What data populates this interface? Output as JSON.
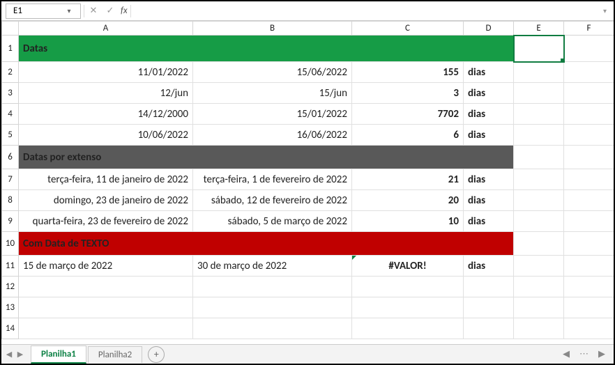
{
  "nameBox": {
    "value": "E1"
  },
  "fx": {
    "cancel": "✕",
    "confirm": "✓",
    "label": "fx"
  },
  "columns": [
    "A",
    "B",
    "C",
    "D",
    "E",
    "F"
  ],
  "rowNums": [
    "1",
    "2",
    "3",
    "4",
    "5",
    "6",
    "7",
    "8",
    "9",
    "10",
    "11",
    "12",
    "13",
    "14"
  ],
  "section1": {
    "title": "Datas"
  },
  "rows": {
    "r2": {
      "a": "11/01/2022",
      "b": "15/06/2022",
      "c": "155",
      "d": "dias"
    },
    "r3": {
      "a": "12/jun",
      "b": "15/jun",
      "c": "3",
      "d": "dias"
    },
    "r4": {
      "a": "14/12/2000",
      "b": "15/01/2022",
      "c": "7702",
      "d": "dias"
    },
    "r5": {
      "a": "10/06/2022",
      "b": "16/06/2022",
      "c": "6",
      "d": "dias"
    }
  },
  "section2": {
    "title": "Datas por extenso"
  },
  "rows2": {
    "r7": {
      "a": "terça-feira, 11 de janeiro de 2022",
      "b": "terça-feira, 1 de fevereiro de 2022",
      "c": "21",
      "d": "dias"
    },
    "r8": {
      "a": "domingo, 23 de janeiro de 2022",
      "b": "sábado, 12 de fevereiro de 2022",
      "c": "20",
      "d": "dias"
    },
    "r9": {
      "a": "quarta-feira, 23 de fevereiro de 2022",
      "b": "sábado, 5 de março de 2022",
      "c": "10",
      "d": "dias"
    }
  },
  "section3": {
    "title": "Com Data de TEXTO"
  },
  "rows3": {
    "r11": {
      "a": "15 de março de 2022",
      "b": "30 de março de 2022",
      "c": "#VALOR!",
      "d": "dias"
    }
  },
  "tabs": {
    "items": [
      {
        "label": "Planilha1",
        "active": true
      },
      {
        "label": "Planilha2",
        "active": false
      }
    ],
    "add": "+"
  },
  "nav": {
    "prev": "◀",
    "next": "▶",
    "dots": "⋯"
  }
}
